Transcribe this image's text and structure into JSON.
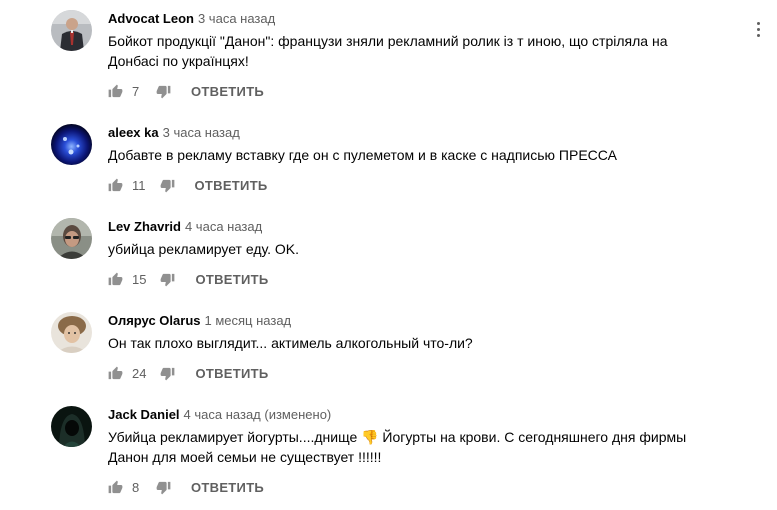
{
  "comments": [
    {
      "author": "Advocat Leon",
      "time": "3 часа назад",
      "text": "Бойкот продукції \"Данон\": французи зняли рекламний ролик із т      иною, що стріляла на Донбасі по українцях!",
      "likes": "7",
      "reply_label": "ОТВЕТИТЬ",
      "avatar_icon": "avatar-man-suit"
    },
    {
      "author": "aleex ka",
      "time": "3 часа назад",
      "text": "Добавте в рекламу вставку где он с пулеметом и в каске с надписью ПРЕССА",
      "likes": "11",
      "reply_label": "ОТВЕТИТЬ",
      "avatar_icon": "avatar-blue-light"
    },
    {
      "author": "Lev Zhavrid",
      "time": "4 часа назад",
      "text": "убийца рекламирует еду. OK.",
      "likes": "15",
      "reply_label": "ОТВЕТИТЬ",
      "avatar_icon": "avatar-person-glasses"
    },
    {
      "author": "Олярус Olarus",
      "time": "1 месяц назад",
      "text": "Он так плохо выглядит... актимель алкогольный что-ли?",
      "likes": "24",
      "reply_label": "ОТВЕТИТЬ",
      "avatar_icon": "avatar-person-fur-hat"
    },
    {
      "author": "Jack Daniel",
      "time": "4 часа назад (изменено)",
      "text": "Убийца рекламирует йогурты....днище 👎 Йогурты на крови. С сегодняшнего дня фирмы Данон для моей семьи не существует !!!!!!",
      "likes": "8",
      "reply_label": "ОТВЕТИТЬ",
      "avatar_icon": "avatar-hooded-figure"
    }
  ],
  "colors": {
    "text": "#030303",
    "secondary": "#606060",
    "icon": "#909090"
  }
}
